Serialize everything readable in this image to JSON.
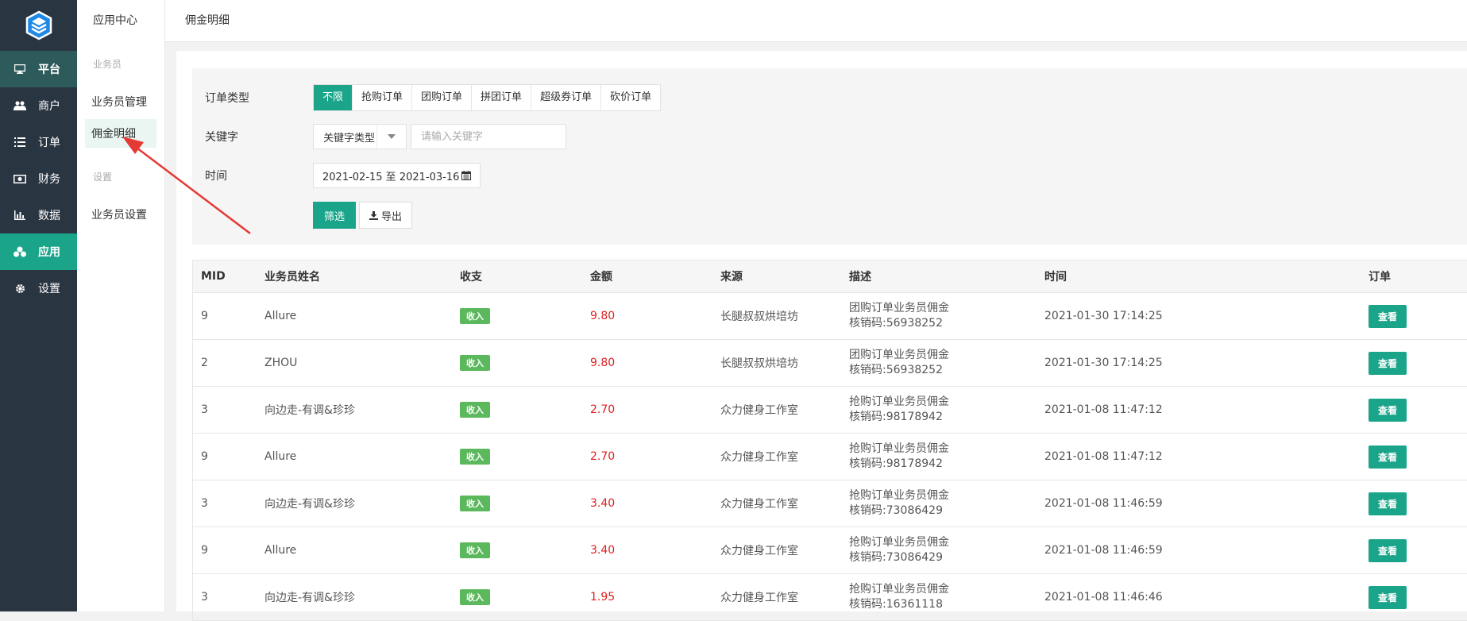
{
  "nav": {
    "items": [
      {
        "label": "平台",
        "icon": "monitor-icon"
      },
      {
        "label": "商户",
        "icon": "users-icon"
      },
      {
        "label": "订单",
        "icon": "list-icon"
      },
      {
        "label": "财务",
        "icon": "money-icon"
      },
      {
        "label": "数据",
        "icon": "bar-chart-icon"
      },
      {
        "label": "应用",
        "icon": "cubes-icon"
      },
      {
        "label": "设置",
        "icon": "gear-icon"
      }
    ]
  },
  "subnav": {
    "header": "应用中心",
    "group1": "业务员",
    "item_manage": "业务员管理",
    "item_commission": "佣金明细",
    "group2": "设置",
    "item_settings": "业务员设置"
  },
  "topbar": {
    "title": "佣金明细"
  },
  "filter": {
    "order_type_label": "订单类型",
    "order_types": [
      "不限",
      "抢购订单",
      "团购订单",
      "拼团订单",
      "超级券订单",
      "砍价订单"
    ],
    "keyword_label": "关键字",
    "keyword_type": "关键字类型",
    "keyword_placeholder": "请输入关键字",
    "time_label": "时间",
    "date_range": "2021-02-15 至 2021-03-16",
    "filter_button": "筛选",
    "export_button": "导出"
  },
  "table": {
    "headers": [
      "MID",
      "业务员姓名",
      "收支",
      "金额",
      "来源",
      "描述",
      "时间",
      "订单"
    ],
    "rows": [
      {
        "mid": "9",
        "name": "Allure",
        "type": "收入",
        "amount": "9.80",
        "source": "长腿叔叔烘培坊",
        "desc1": "团购订单业务员佣金",
        "desc2": "核销码:56938252",
        "time": "2021-01-30 17:14:25",
        "action": "查看"
      },
      {
        "mid": "2",
        "name": "ZHOU",
        "type": "收入",
        "amount": "9.80",
        "source": "长腿叔叔烘培坊",
        "desc1": "团购订单业务员佣金",
        "desc2": "核销码:56938252",
        "time": "2021-01-30 17:14:25",
        "action": "查看"
      },
      {
        "mid": "3",
        "name": "向边走-有调&珍珍",
        "type": "收入",
        "amount": "2.70",
        "source": "众力健身工作室",
        "desc1": "抢购订单业务员佣金",
        "desc2": "核销码:98178942",
        "time": "2021-01-08 11:47:12",
        "action": "查看"
      },
      {
        "mid": "9",
        "name": "Allure",
        "type": "收入",
        "amount": "2.70",
        "source": "众力健身工作室",
        "desc1": "抢购订单业务员佣金",
        "desc2": "核销码:98178942",
        "time": "2021-01-08 11:47:12",
        "action": "查看"
      },
      {
        "mid": "3",
        "name": "向边走-有调&珍珍",
        "type": "收入",
        "amount": "3.40",
        "source": "众力健身工作室",
        "desc1": "抢购订单业务员佣金",
        "desc2": "核销码:73086429",
        "time": "2021-01-08 11:46:59",
        "action": "查看"
      },
      {
        "mid": "9",
        "name": "Allure",
        "type": "收入",
        "amount": "3.40",
        "source": "众力健身工作室",
        "desc1": "抢购订单业务员佣金",
        "desc2": "核销码:73086429",
        "time": "2021-01-08 11:46:59",
        "action": "查看"
      },
      {
        "mid": "3",
        "name": "向边走-有调&珍珍",
        "type": "收入",
        "amount": "1.95",
        "source": "众力健身工作室",
        "desc1": "抢购订单业务员佣金",
        "desc2": "核销码:16361118",
        "time": "2021-01-08 11:46:46",
        "action": "查看"
      }
    ]
  },
  "colors": {
    "accent": "#1aa58a",
    "nav_bg": "#2a3542",
    "income_badge": "#5cb85c",
    "amount": "#e02020",
    "annotation_arrow": "#e53935"
  }
}
